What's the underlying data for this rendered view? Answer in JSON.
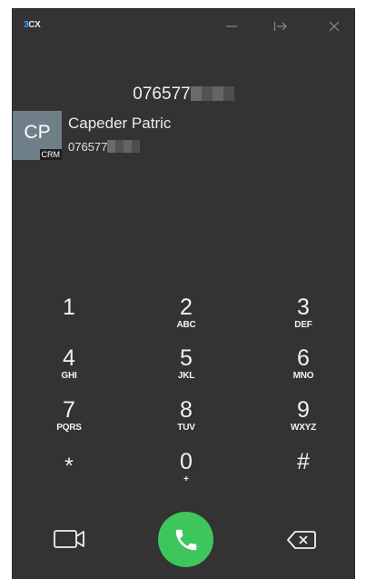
{
  "app": {
    "logo_prefix": "3",
    "logo_suffix": "CX"
  },
  "display": {
    "number": "076577"
  },
  "contact": {
    "initials": "CP",
    "badge": "CRM",
    "name": "Capeder Patric",
    "number": "076577"
  },
  "keypad": {
    "keys": [
      {
        "digit": "1",
        "letters": ""
      },
      {
        "digit": "2",
        "letters": "ABC"
      },
      {
        "digit": "3",
        "letters": "DEF"
      },
      {
        "digit": "4",
        "letters": "GHI"
      },
      {
        "digit": "5",
        "letters": "JKL"
      },
      {
        "digit": "6",
        "letters": "MNO"
      },
      {
        "digit": "7",
        "letters": "PQRS"
      },
      {
        "digit": "8",
        "letters": "TUV"
      },
      {
        "digit": "9",
        "letters": "WXYZ"
      },
      {
        "digit": "*",
        "letters": ""
      },
      {
        "digit": "0",
        "letters": "+"
      },
      {
        "digit": "#",
        "letters": ""
      }
    ]
  },
  "colors": {
    "background": "#333333",
    "call_button": "#3ec65c",
    "avatar": "#6f7f88",
    "logo_accent": "#3aa0ff"
  },
  "icons": {
    "minimize": "minimize-icon",
    "popout": "popout-icon",
    "close": "close-icon",
    "video": "video-camera-icon",
    "call": "phone-icon",
    "backspace": "backspace-icon"
  }
}
